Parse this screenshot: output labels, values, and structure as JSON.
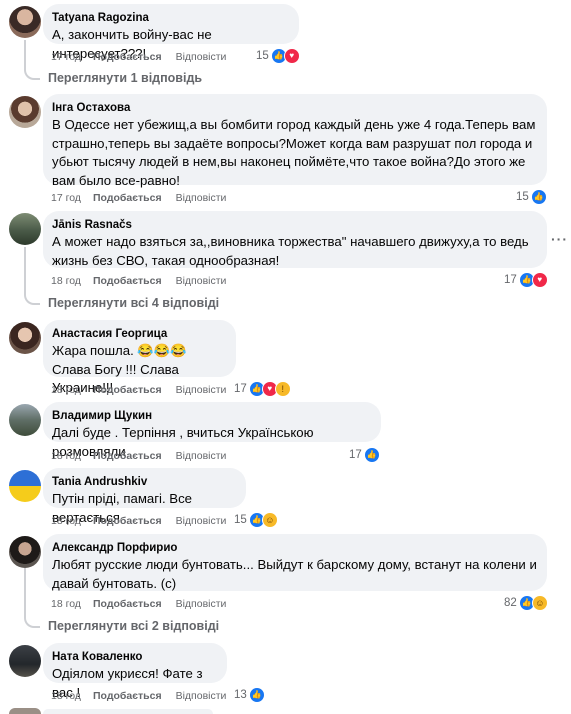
{
  "comments": [
    {
      "author": "Tatyana Ragozina",
      "text": "А, закончить войну-вас не интересует???!",
      "time": "17 год",
      "like_label": "Подобається",
      "reply_label": "Відповісти",
      "reactions": "15",
      "icons": [
        "like-icon",
        "love-icon"
      ]
    },
    {
      "author": "Інга Остахова",
      "text": "В Одессе нет убежищ,а вы бомбити город каждый день уже 4 года.Теперь вам страшно,теперь вы задаёте вопросы?Может когда вам разрушат пол города и убьют тысячу людей в нем,вы наконец поймёте,что такое война?До этого же вам было все-равно!",
      "time": "17 год",
      "like_label": "Подобається",
      "reply_label": "Відповісти",
      "reactions": "15",
      "icons": [
        "like-icon"
      ]
    },
    {
      "author": "Jānis Rasnačs",
      "text": "А может надо взяться за,,виновника торжества\" начавшего движуху,а то ведь жизнь без СВО, такая однообразная!",
      "time": "18 год",
      "like_label": "Подобається",
      "reply_label": "Відповісти",
      "reactions": "17",
      "icons": [
        "like-icon",
        "love-icon"
      ]
    },
    {
      "author": "Анастасия Георгица",
      "text": "Жара пошла. 😂😂😂\nСлава Богу !!! Слава Украине!!!",
      "time": "18 год",
      "like_label": "Подобається",
      "reply_label": "Відповісти",
      "reactions": "17",
      "icons": [
        "like-icon",
        "love-icon",
        "wow-icon"
      ]
    },
    {
      "author": "Владимир Щукин",
      "text": "Далі буде . Терпіння , вчиться Українською розмовляли",
      "time": "18 год",
      "like_label": "Подобається",
      "reply_label": "Відповісти",
      "reactions": "17",
      "icons": [
        "like-icon"
      ]
    },
    {
      "author": "Tania Andrushkiv",
      "text": "Путін пріді, памагі. Все вертається",
      "time": "18 год",
      "like_label": "Подобається",
      "reply_label": "Відповісти",
      "reactions": "15",
      "icons": [
        "like-icon",
        "haha-icon"
      ]
    },
    {
      "author": "Александр Порфирио",
      "text": "Любят русские люди бунтовать... Выйдут к барскому дому, встанут на колени и давай бунтовать. (с)",
      "time": "18 год",
      "like_label": "Подобається",
      "reply_label": "Відповісти",
      "reactions": "82",
      "icons": [
        "like-icon",
        "haha-icon"
      ]
    },
    {
      "author": "Ната Коваленко",
      "text": "Одіялом укриєся! Фате з вас !",
      "time": "18 год",
      "like_label": "Подобається",
      "reply_label": "Відповісти",
      "reactions": "13",
      "icons": [
        "like-icon"
      ]
    }
  ],
  "reply_links": {
    "r1": "Переглянути 1 відповідь",
    "r3": "Переглянути всі 4 відповіді",
    "r7": "Переглянути всі 2 відповіді"
  },
  "more_options": "···",
  "colors": {
    "bubble": "#f0f2f5",
    "meta": "#65676b",
    "like": "#1877f2",
    "love": "#f02849",
    "haha": "#f7b928"
  }
}
